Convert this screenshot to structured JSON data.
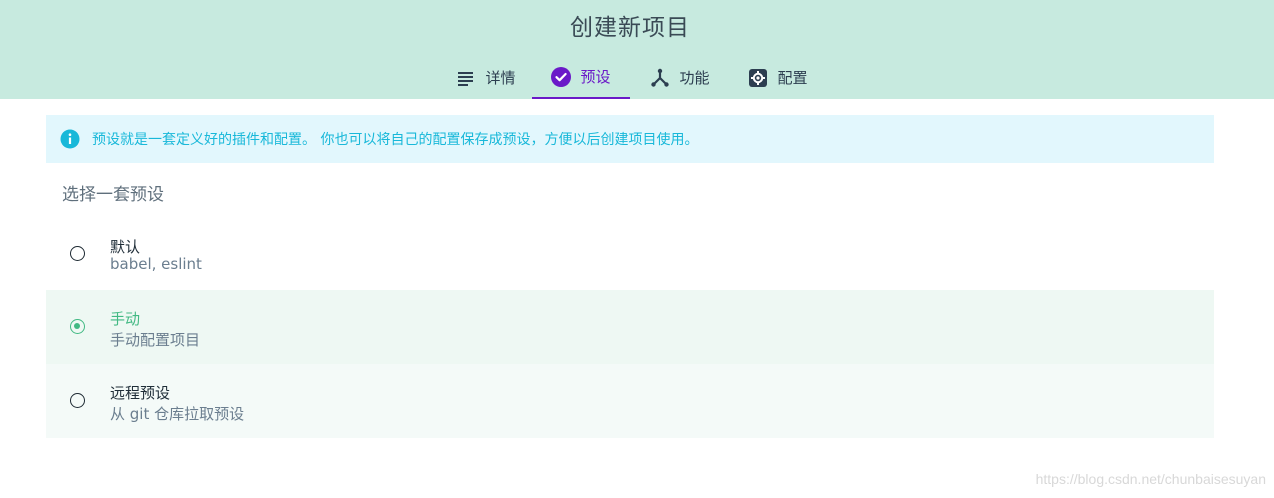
{
  "header": {
    "title": "创建新项目",
    "tabs": [
      {
        "label": "详情",
        "icon": "list-icon",
        "active": false
      },
      {
        "label": "预设",
        "icon": "check-circle-icon",
        "active": true
      },
      {
        "label": "功能",
        "icon": "fork-icon",
        "active": false
      },
      {
        "label": "配置",
        "icon": "gear-icon",
        "active": false
      }
    ]
  },
  "info": {
    "icon": "info-icon",
    "text": "预设就是一套定义好的插件和配置。 你也可以将自己的配置保存成预设，方便以后创建项目使用。"
  },
  "section": {
    "title": "选择一套预设"
  },
  "presets": [
    {
      "title": "默认",
      "description": "babel, eslint",
      "selected": false
    },
    {
      "title": "手动",
      "description": "手动配置项目",
      "selected": true
    },
    {
      "title": "远程预设",
      "description": "从 git 仓库拉取预设",
      "selected": false
    }
  ],
  "watermark": "https://blog.csdn.net/chunbaisesuyan",
  "colors": {
    "header_bg": "#c7eadf",
    "accent_purple": "#6a19c8",
    "accent_green": "#42b983",
    "info_bg": "#e2f7fd",
    "info_text": "#18b8d9"
  }
}
